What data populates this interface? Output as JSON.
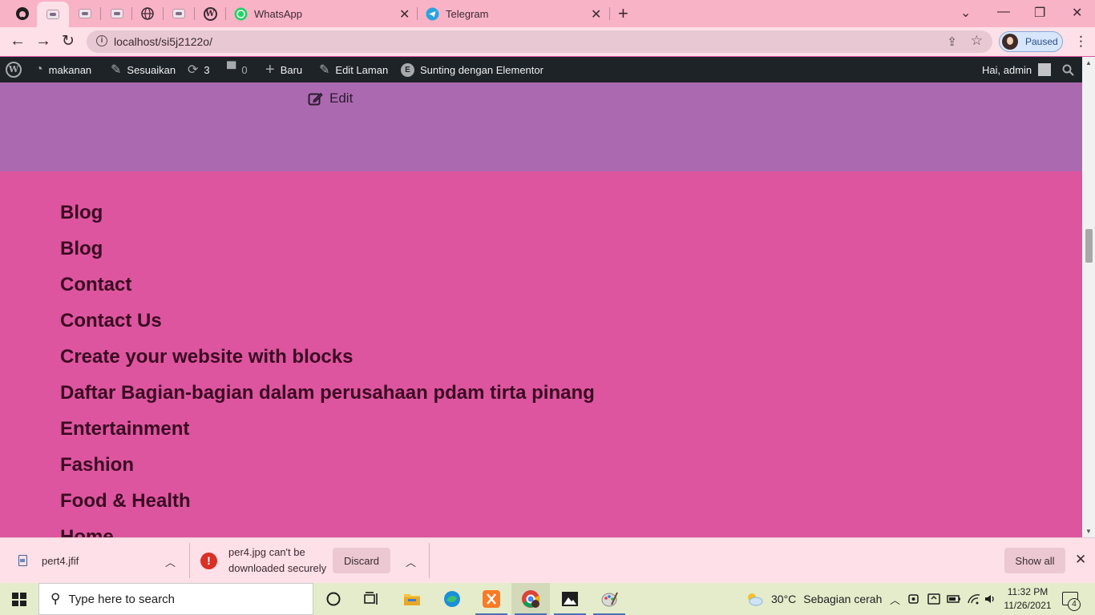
{
  "browser": {
    "tabs": [
      {
        "label": "WhatsApp",
        "icon": "whatsapp-icon"
      },
      {
        "label": "Telegram",
        "icon": "telegram-icon"
      }
    ],
    "new_tab_label": "+",
    "url": "localhost/si5j2122o/",
    "profile_status": "Paused"
  },
  "admin_bar": {
    "site_name": "makanan",
    "customize": "Sesuaikan",
    "updates_count": "3",
    "comments_count": "0",
    "new": "Baru",
    "edit_page": "Edit Laman",
    "elementor": "Sunting dengan Elementor",
    "greeting": "Hai, admin"
  },
  "content": {
    "edit_label": "Edit",
    "pages": [
      "Blog",
      "Blog",
      "Contact",
      "Contact Us",
      "Create your website with blocks",
      "Daftar Bagian-bagian dalam perusahaan pdam tirta pinang",
      "Entertainment",
      "Fashion",
      "Food & Health",
      "Home"
    ]
  },
  "downloads": {
    "file1": "pert4.jfif",
    "file2_warning": "per4.jpg can't be downloaded securely",
    "discard_label": "Discard",
    "show_all_label": "Show all"
  },
  "taskbar": {
    "search_placeholder": "Type here to search",
    "weather_temp": "30°C",
    "weather_desc": "Sebagian cerah",
    "time": "11:32 PM",
    "date": "11/26/2021",
    "notification_count": "4"
  },
  "colors": {
    "tab_strip": "#f8b3c7",
    "purple_section": "#ab6aaf",
    "pink_section": "#dd559f",
    "page_link": "#3a0a22",
    "admin_bar": "#1d2327"
  }
}
